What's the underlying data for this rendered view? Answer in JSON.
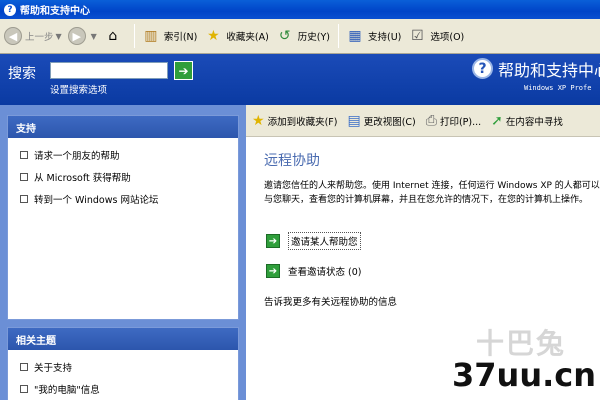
{
  "window": {
    "title": "帮助和支持中心"
  },
  "toolbar": {
    "back": "上一步",
    "index": "索引(N)",
    "favorites": "收藏夹(A)",
    "history": "历史(Y)",
    "support": "支持(U)",
    "options": "选项(O)"
  },
  "search": {
    "label": "搜索",
    "value": "",
    "options_link": "设置搜索选项"
  },
  "brand": {
    "title": "帮助和支持中心",
    "subtitle": "Windows XP Profe"
  },
  "sidebar": {
    "support_panel": {
      "title": "支持",
      "items": [
        {
          "label": "请求一个朋友的帮助"
        },
        {
          "label": "从 Microsoft 获得帮助"
        },
        {
          "label": "转到一个 Windows 网站论坛"
        }
      ]
    },
    "related_panel": {
      "title": "相关主题",
      "items": [
        {
          "label": "关于支持"
        },
        {
          "label": "\"我的电脑\"信息"
        }
      ]
    }
  },
  "content_toolbar": {
    "add_favorites": "添加到收藏夹(F)",
    "change_view": "更改视图(C)",
    "print": "打印(P)...",
    "find_in_content": "在内容中寻找"
  },
  "content": {
    "heading": "远程协助",
    "description": "邀请您信任的人来帮助您。使用 Internet 连接，任何运行 Windows XP 的人都可以与您聊天，查看您的计算机屏幕，并且在您允许的情况下，在您的计算机上操作。",
    "actions": [
      {
        "label": "邀请某人帮助您"
      },
      {
        "label": "查看邀请状态 (0)"
      }
    ],
    "more_link": "告诉我更多有关远程协助的信息"
  },
  "watermarks": {
    "top": "十巴兔",
    "site": "37uu.cn"
  }
}
